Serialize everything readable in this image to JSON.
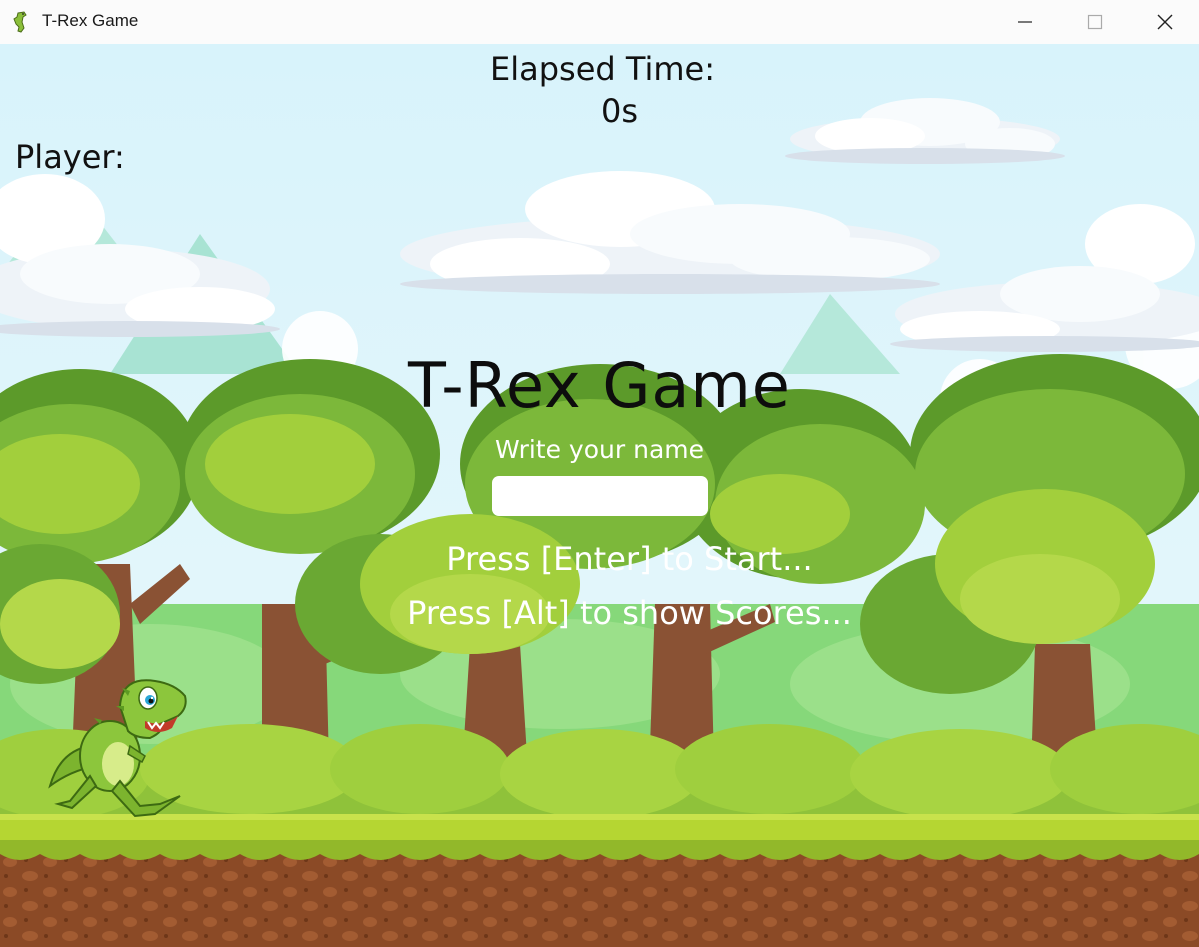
{
  "window": {
    "title": "T-Rex Game",
    "icon": "trex-icon",
    "controls": [
      "minimize-icon",
      "maximize-icon",
      "close-icon"
    ]
  },
  "hud": {
    "elapsed_label": "Elapsed Time:",
    "elapsed_value": "0s",
    "player_label": "Player:"
  },
  "menu": {
    "title": "T-Rex Game",
    "name_prompt": "Write your name",
    "name_value": "",
    "start_hint": "Press [Enter] to Start...",
    "scores_hint": "Press [Alt] to show Scores..."
  },
  "colors": {
    "sky": "#d8f3fb",
    "grass": "#a8d030",
    "dirt": "#8b4a26",
    "text_dark": "#111111",
    "text_light": "#ffffff"
  }
}
